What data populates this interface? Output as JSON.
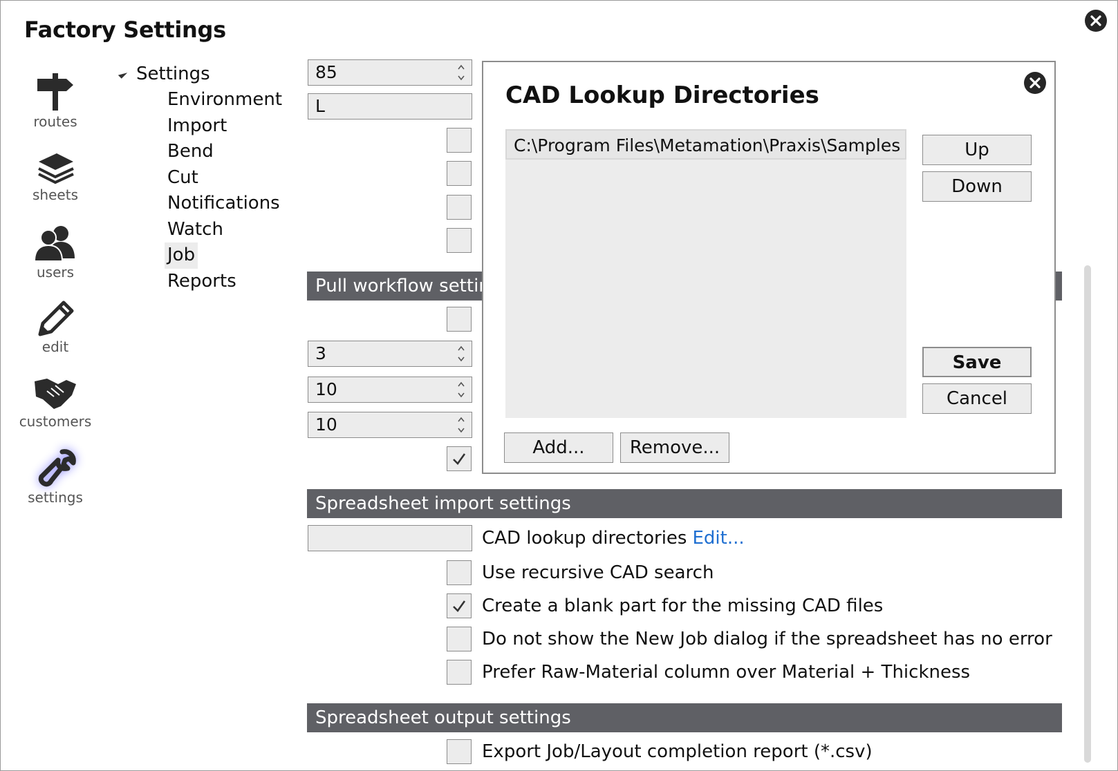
{
  "window": {
    "title": "Factory Settings"
  },
  "nav": [
    {
      "label": "routes",
      "icon": "signpost-icon"
    },
    {
      "label": "sheets",
      "icon": "layers-icon"
    },
    {
      "label": "users",
      "icon": "users-icon"
    },
    {
      "label": "edit",
      "icon": "pencil-icon"
    },
    {
      "label": "customers",
      "icon": "handshake-icon"
    },
    {
      "label": "settings",
      "icon": "wrench-icon",
      "active": true
    }
  ],
  "tree": {
    "root": "Settings",
    "items": [
      "Environment",
      "Import",
      "Bend",
      "Cut",
      "Notifications",
      "Watch",
      "Job",
      "Reports"
    ],
    "selected": "Job"
  },
  "fields": {
    "spin1": "85",
    "text1": "L",
    "spin2": "3",
    "spin3": "10",
    "spin4": "10",
    "cad_dirs": ""
  },
  "sections": {
    "pull": "Pull workflow settin",
    "import": "Spreadsheet import settings",
    "output": "Spreadsheet output settings"
  },
  "import_settings": {
    "cad_lookup_label": "CAD lookup directories",
    "edit_link": "Edit...",
    "recursive": "Use recursive CAD search",
    "blank_part": "Create a blank part for the missing CAD files",
    "no_dialog": "Do not show the New Job dialog if the spreadsheet has no error",
    "prefer_raw": "Prefer Raw-Material column over Material + Thickness"
  },
  "output_settings": {
    "export_report": "Export Job/Layout completion report (*.csv)"
  },
  "dialog": {
    "title": "CAD Lookup Directories",
    "directories": [
      "C:\\Program Files\\Metamation\\Praxis\\Samples"
    ],
    "buttons": {
      "up": "Up",
      "down": "Down",
      "save": "Save",
      "cancel": "Cancel",
      "add": "Add...",
      "remove": "Remove..."
    }
  },
  "colors": {
    "section_bg": "#5f6065",
    "link": "#1f6fd1",
    "control_bg": "#ececec",
    "active_glow": "#8f8cff"
  }
}
